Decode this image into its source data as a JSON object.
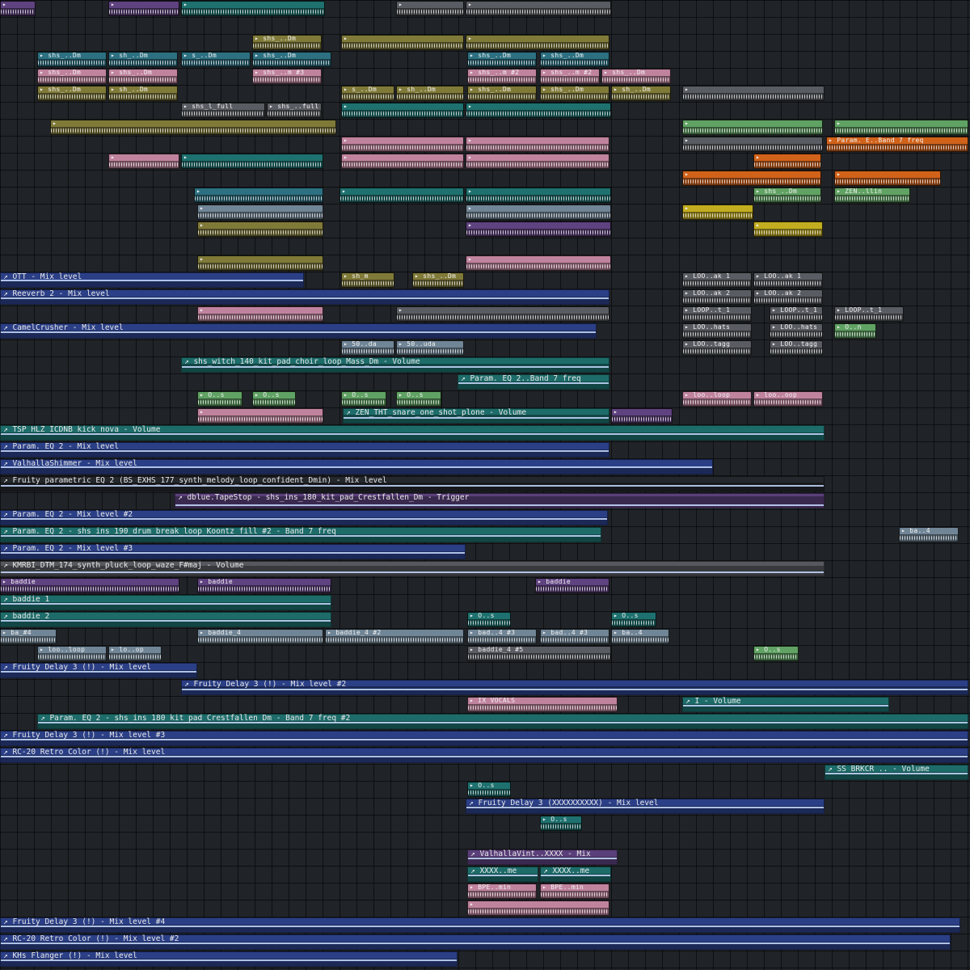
{
  "app": {
    "name": "FL Studio",
    "view": "Playlist"
  },
  "colors": {
    "blue": "#2b3f86",
    "teal": "#1d6c6a",
    "purple": "#5a3f7a",
    "pink": "#b77d96",
    "olive": "#7a7436",
    "cyan": "#2a6b7b",
    "gray": "#55585d",
    "orange": "#c75d19",
    "yellow": "#b9a51e",
    "green": "#5b9a5e",
    "steel": "#6b7f8f"
  },
  "automation": [
    {
      "label": "OTT - Mix level",
      "row": 16,
      "start": 0,
      "end": 376,
      "color": "blue",
      "level": 0.55
    },
    {
      "label": "Reeverb 2 - Mix level",
      "row": 17,
      "start": 0,
      "end": 754,
      "color": "blue",
      "level": 0.45
    },
    {
      "label": "CamelCrusher - Mix level",
      "row": 19,
      "start": 0,
      "end": 738,
      "color": "blue",
      "level": 0.5
    },
    {
      "label": "shs_witch_140_kit_pad_choir_loop_Mass_Dm - Volume",
      "row": 21,
      "start": 224,
      "end": 754,
      "color": "teal",
      "level": 0.4
    },
    {
      "label": "Param. EQ 2..Band 7 freq",
      "row": 22,
      "start": 566,
      "end": 754,
      "color": "teal",
      "level": 0.5
    },
    {
      "label": "ZEN_THT_snare_one_shot_plone - Volume",
      "row": 24,
      "start": 424,
      "end": 754,
      "color": "teal",
      "level": 0.4
    },
    {
      "label": "TSP_HLZ_ICDNB_kick_nova - Volume",
      "row": 25,
      "start": 0,
      "end": 1020,
      "color": "teal",
      "level": 0.45
    },
    {
      "label": "Param. EQ 2 - Mix level",
      "row": 26,
      "start": 0,
      "end": 754,
      "color": "blue",
      "level": 0.5
    },
    {
      "label": "ValhallaShimmer - Mix level",
      "row": 27,
      "start": 0,
      "end": 882,
      "color": "blue",
      "level": 0.55
    },
    {
      "label": "Fruity parametric EQ 2 (BS_EXHS_177_synth_melody_loop_confident_Dmin) - Mix level",
      "row": 28,
      "start": 0,
      "end": 1020,
      "color": "dark",
      "level": 0.4
    },
    {
      "label": "dblue.TapeStop - shs_ins_180_kit_pad_Crestfallen_Dm - Trigger",
      "row": 29,
      "start": 216,
      "end": 1020,
      "color": "purple",
      "level": 0.2
    },
    {
      "label": "Param. EQ 2 - Mix level #2",
      "row": 30,
      "start": 0,
      "end": 752,
      "color": "blue",
      "level": 0.5
    },
    {
      "label": "Param. EQ 2 - shs_ins_190_drum_break_loop_Koontz_fill #2 - Band 7 freq",
      "row": 31,
      "start": 0,
      "end": 744,
      "color": "teal",
      "level": 0.5
    },
    {
      "label": "Param. EQ 2 - Mix level #3",
      "row": 32,
      "start": 0,
      "end": 576,
      "color": "blue",
      "level": 0.5
    },
    {
      "label": "KMRBI_DTM_174_synth_pluck_loop_waze_F#maj - Volume",
      "row": 33,
      "start": 0,
      "end": 1020,
      "color": "gray",
      "level": 0.3
    },
    {
      "label": "baddie_1",
      "row": 35,
      "start": 0,
      "end": 410,
      "color": "teal",
      "level": 0.5
    },
    {
      "label": "baddie_2",
      "row": 36,
      "start": 0,
      "end": 410,
      "color": "teal",
      "level": 0.5
    },
    {
      "label": "Fruity Delay 3 (!) - Mix level",
      "row": 39,
      "start": 0,
      "end": 244,
      "color": "blue",
      "level": 0.5
    },
    {
      "label": "Fruity Delay 3 (!) - Mix level #2",
      "row": 40,
      "start": 224,
      "end": 1198,
      "color": "blue",
      "level": 0.4
    },
    {
      "label": "I - Volume",
      "row": 41,
      "start": 844,
      "end": 1100,
      "color": "teal",
      "level": 0.5
    },
    {
      "label": "Param. EQ 2 - shs_ins_180_kit_pad_Crestfallen_Dm - Band 7 freq #2",
      "row": 42,
      "start": 46,
      "end": 1198,
      "color": "teal",
      "level": 0.5
    },
    {
      "label": "Fruity Delay 3 (!) - Mix level #3",
      "row": 43,
      "start": 0,
      "end": 1198,
      "color": "blue",
      "level": 0.5
    },
    {
      "label": "RC-20 Retro Color (!) - Mix level",
      "row": 44,
      "start": 0,
      "end": 1198,
      "color": "blue",
      "level": 0.5
    },
    {
      "label": "SS_BRKCR_.. - Volume",
      "row": 45,
      "start": 1020,
      "end": 1198,
      "color": "teal",
      "level": 0.5
    },
    {
      "label": "Fruity Delay 3 (XXXXXXXXXX) - Mix level",
      "row": 47,
      "start": 576,
      "end": 1020,
      "color": "blue",
      "level": 0.5
    },
    {
      "label": "ValhallaVint..XXXX - Mix",
      "row": 50,
      "start": 578,
      "end": 764,
      "color": "purple",
      "level": 0.5
    },
    {
      "label": "XXXX..me",
      "row": 51,
      "start": 578,
      "end": 666,
      "color": "teal",
      "level": 0.5
    },
    {
      "label": "XXXX..me",
      "row": 51,
      "start": 668,
      "end": 756,
      "color": "teal",
      "level": 0.5
    },
    {
      "label": "Fruity Delay 3 (!) - Mix level #4",
      "row": 54,
      "start": 0,
      "end": 1188,
      "color": "blue",
      "level": 0.5
    },
    {
      "label": "RC-20 Retro Color (!) - Mix level #2",
      "row": 55,
      "start": 0,
      "end": 1176,
      "color": "blue",
      "level": 0.5
    },
    {
      "label": "KHs Flanger (!) - Mix level",
      "row": 56,
      "start": 0,
      "end": 566,
      "color": "blue",
      "level": 0.5
    }
  ],
  "clips": [
    {
      "label": "",
      "row": 0,
      "start": 0,
      "end": 44,
      "color": "purple"
    },
    {
      "label": "",
      "row": 0,
      "start": 134,
      "end": 222,
      "color": "purple"
    },
    {
      "label": "",
      "row": 0,
      "start": 224,
      "end": 402,
      "color": "teal"
    },
    {
      "label": "",
      "row": 0,
      "start": 490,
      "end": 574,
      "color": "gray"
    },
    {
      "label": "",
      "row": 0,
      "start": 576,
      "end": 756,
      "color": "gray"
    },
    {
      "label": "shs_..Dm",
      "row": 2,
      "start": 312,
      "end": 398,
      "color": "olive"
    },
    {
      "label": "",
      "row": 2,
      "start": 422,
      "end": 574,
      "color": "olive"
    },
    {
      "label": "",
      "row": 2,
      "start": 576,
      "end": 754,
      "color": "olive"
    },
    {
      "label": "shs_..Dm",
      "row": 3,
      "start": 46,
      "end": 132,
      "color": "cyan"
    },
    {
      "label": "sh_..Dm",
      "row": 3,
      "start": 134,
      "end": 220,
      "color": "cyan"
    },
    {
      "label": "s_..Dm",
      "row": 3,
      "start": 224,
      "end": 310,
      "color": "cyan"
    },
    {
      "label": "shs_..Dm",
      "row": 3,
      "start": 312,
      "end": 410,
      "color": "cyan"
    },
    {
      "label": "shs_..Dm",
      "row": 3,
      "start": 578,
      "end": 664,
      "color": "cyan"
    },
    {
      "label": "shs_..Dm",
      "row": 3,
      "start": 668,
      "end": 754,
      "color": "cyan"
    },
    {
      "label": "shs_..Dm",
      "row": 4,
      "start": 46,
      "end": 132,
      "color": "pink"
    },
    {
      "label": "shs_..Dm",
      "row": 4,
      "start": 134,
      "end": 220,
      "color": "pink"
    },
    {
      "label": "shs_..m #3",
      "row": 4,
      "start": 312,
      "end": 398,
      "color": "pink"
    },
    {
      "label": "shs_..m #2",
      "row": 4,
      "start": 578,
      "end": 664,
      "color": "pink"
    },
    {
      "label": "shs_..m #2",
      "row": 4,
      "start": 668,
      "end": 742,
      "color": "pink"
    },
    {
      "label": "shs_..Dm",
      "row": 4,
      "start": 744,
      "end": 830,
      "color": "pink"
    },
    {
      "label": "shs_..Dm",
      "row": 5,
      "start": 46,
      "end": 132,
      "color": "olive"
    },
    {
      "label": "sh_..Dm",
      "row": 5,
      "start": 134,
      "end": 220,
      "color": "olive"
    },
    {
      "label": "s_..Dm",
      "row": 5,
      "start": 422,
      "end": 488,
      "color": "olive"
    },
    {
      "label": "sh_..Dm",
      "row": 5,
      "start": 490,
      "end": 574,
      "color": "olive"
    },
    {
      "label": "shs_..Dm",
      "row": 5,
      "start": 578,
      "end": 664,
      "color": "olive"
    },
    {
      "label": "shs_..Dm",
      "row": 5,
      "start": 668,
      "end": 754,
      "color": "olive"
    },
    {
      "label": "sh_..Dm",
      "row": 5,
      "start": 756,
      "end": 830,
      "color": "olive"
    },
    {
      "label": "shs_l_full",
      "row": 6,
      "start": 224,
      "end": 328,
      "color": "gray"
    },
    {
      "label": "shs_..full",
      "row": 6,
      "start": 330,
      "end": 398,
      "color": "gray"
    },
    {
      "label": "",
      "row": 6,
      "start": 422,
      "end": 574,
      "color": "teal"
    },
    {
      "label": "",
      "row": 6,
      "start": 576,
      "end": 756,
      "color": "teal"
    },
    {
      "label": "",
      "row": 5,
      "start": 844,
      "end": 1020,
      "color": "gray"
    },
    {
      "label": "",
      "row": 7,
      "start": 62,
      "end": 416,
      "color": "olive"
    },
    {
      "label": "",
      "row": 7,
      "start": 844,
      "end": 1018,
      "color": "green"
    },
    {
      "label": "",
      "row": 7,
      "start": 1032,
      "end": 1198,
      "color": "green"
    },
    {
      "label": "",
      "row": 8,
      "start": 422,
      "end": 574,
      "color": "pink"
    },
    {
      "label": "",
      "row": 8,
      "start": 576,
      "end": 754,
      "color": "pink"
    },
    {
      "label": "",
      "row": 8,
      "start": 844,
      "end": 1018,
      "color": "gray"
    },
    {
      "label": "Param. E..Band 7 freq",
      "row": 8,
      "start": 1022,
      "end": 1198,
      "color": "orange"
    },
    {
      "label": "",
      "row": 9,
      "start": 134,
      "end": 222,
      "color": "pink"
    },
    {
      "label": "",
      "row": 9,
      "start": 224,
      "end": 400,
      "color": "teal"
    },
    {
      "label": "",
      "row": 9,
      "start": 422,
      "end": 574,
      "color": "pink"
    },
    {
      "label": "",
      "row": 9,
      "start": 576,
      "end": 754,
      "color": "pink"
    },
    {
      "label": "",
      "row": 9,
      "start": 932,
      "end": 1016,
      "color": "orange"
    },
    {
      "label": "",
      "row": 10,
      "start": 844,
      "end": 1016,
      "color": "orange"
    },
    {
      "label": "",
      "row": 10,
      "start": 1032,
      "end": 1164,
      "color": "orange"
    },
    {
      "label": "",
      "row": 11,
      "start": 240,
      "end": 400,
      "color": "cyan"
    },
    {
      "label": "",
      "row": 11,
      "start": 420,
      "end": 574,
      "color": "teal"
    },
    {
      "label": "",
      "row": 11,
      "start": 576,
      "end": 756,
      "color": "teal"
    },
    {
      "label": "shs_..Dm",
      "row": 11,
      "start": 932,
      "end": 1016,
      "color": "green"
    },
    {
      "label": "ZEN..llin",
      "row": 11,
      "start": 1032,
      "end": 1126,
      "color": "green"
    },
    {
      "label": "",
      "row": 12,
      "start": 244,
      "end": 400,
      "color": "steel"
    },
    {
      "label": "",
      "row": 12,
      "start": 576,
      "end": 756,
      "color": "steel"
    },
    {
      "label": "",
      "row": 12,
      "start": 844,
      "end": 932,
      "color": "yellow"
    },
    {
      "label": "",
      "row": 13,
      "start": 244,
      "end": 400,
      "color": "olive"
    },
    {
      "label": "",
      "row": 13,
      "start": 576,
      "end": 756,
      "color": "purple"
    },
    {
      "label": "",
      "row": 13,
      "start": 932,
      "end": 1018,
      "color": "yellow"
    },
    {
      "label": "",
      "row": 15,
      "start": 244,
      "end": 400,
      "color": "olive"
    },
    {
      "label": "",
      "row": 15,
      "start": 576,
      "end": 756,
      "color": "pink"
    },
    {
      "label": "sh_m",
      "row": 16,
      "start": 422,
      "end": 488,
      "color": "olive"
    },
    {
      "label": "shs_..Dm",
      "row": 16,
      "start": 510,
      "end": 574,
      "color": "olive"
    },
    {
      "label": "LOO..ak 1",
      "row": 16,
      "start": 844,
      "end": 930,
      "color": "gray"
    },
    {
      "label": "LOO..ak 1",
      "row": 16,
      "start": 932,
      "end": 1018,
      "color": "gray"
    },
    {
      "label": "LOO..ak 2",
      "row": 17,
      "start": 844,
      "end": 930,
      "color": "gray"
    },
    {
      "label": "LOO..ak 2",
      "row": 17,
      "start": 932,
      "end": 1018,
      "color": "gray"
    },
    {
      "label": "",
      "row": 18,
      "start": 244,
      "end": 400,
      "color": "pink"
    },
    {
      "label": "",
      "row": 18,
      "start": 490,
      "end": 754,
      "color": "gray"
    },
    {
      "label": "LOOP..t_1",
      "row": 18,
      "start": 844,
      "end": 930,
      "color": "gray"
    },
    {
      "label": "LOOP..t_1",
      "row": 18,
      "start": 952,
      "end": 1018,
      "color": "gray"
    },
    {
      "label": "LOOP..t_1",
      "row": 18,
      "start": 1032,
      "end": 1118,
      "color": "gray"
    },
    {
      "label": "LOO..hats",
      "row": 19,
      "start": 844,
      "end": 930,
      "color": "gray"
    },
    {
      "label": "LOO..hats",
      "row": 19,
      "start": 952,
      "end": 1018,
      "color": "gray"
    },
    {
      "label": "O..n",
      "row": 19,
      "start": 1032,
      "end": 1084,
      "color": "green"
    },
    {
      "label": "50..da",
      "row": 20,
      "start": 422,
      "end": 488,
      "color": "steel"
    },
    {
      "label": "50..uda",
      "row": 20,
      "start": 490,
      "end": 574,
      "color": "steel"
    },
    {
      "label": "LOO..tagg",
      "row": 20,
      "start": 844,
      "end": 930,
      "color": "gray"
    },
    {
      "label": "LOO..tagg",
      "row": 20,
      "start": 952,
      "end": 1018,
      "color": "gray"
    },
    {
      "label": "O..s",
      "row": 23,
      "start": 244,
      "end": 300,
      "color": "green"
    },
    {
      "label": "O..s",
      "row": 23,
      "start": 312,
      "end": 366,
      "color": "green"
    },
    {
      "label": "O..s",
      "row": 23,
      "start": 422,
      "end": 478,
      "color": "green"
    },
    {
      "label": "O..s",
      "row": 23,
      "start": 490,
      "end": 546,
      "color": "green"
    },
    {
      "label": "loo..loop",
      "row": 23,
      "start": 844,
      "end": 930,
      "color": "pink"
    },
    {
      "label": "loo..oop",
      "row": 23,
      "start": 932,
      "end": 1018,
      "color": "pink"
    },
    {
      "label": "",
      "row": 24,
      "start": 244,
      "end": 400,
      "color": "pink"
    },
    {
      "label": "",
      "row": 24,
      "start": 756,
      "end": 832,
      "color": "purple"
    },
    {
      "label": "baddie",
      "row": 34,
      "start": 0,
      "end": 222,
      "color": "purple"
    },
    {
      "label": "baddie",
      "row": 34,
      "start": 244,
      "end": 410,
      "color": "purple"
    },
    {
      "label": "baddie",
      "row": 34,
      "start": 662,
      "end": 754,
      "color": "purple"
    },
    {
      "label": "O..s",
      "row": 36,
      "start": 578,
      "end": 632,
      "color": "teal"
    },
    {
      "label": "O..s",
      "row": 36,
      "start": 756,
      "end": 812,
      "color": "teal"
    },
    {
      "label": "ba_#4",
      "row": 37,
      "start": 0,
      "end": 70,
      "color": "steel"
    },
    {
      "label": "baddie_4",
      "row": 37,
      "start": 244,
      "end": 400,
      "color": "steel"
    },
    {
      "label": "baddie_4 #2",
      "row": 37,
      "start": 402,
      "end": 574,
      "color": "steel"
    },
    {
      "label": "bad..4 #3",
      "row": 37,
      "start": 578,
      "end": 664,
      "color": "steel"
    },
    {
      "label": "bad..4 #3",
      "row": 37,
      "start": 668,
      "end": 754,
      "color": "steel"
    },
    {
      "label": "ba..4",
      "row": 37,
      "start": 756,
      "end": 828,
      "color": "steel"
    },
    {
      "label": "loo..loop",
      "row": 38,
      "start": 46,
      "end": 132,
      "color": "steel"
    },
    {
      "label": "lo..op",
      "row": 38,
      "start": 134,
      "end": 200,
      "color": "steel"
    },
    {
      "label": "baddie_4 #5",
      "row": 38,
      "start": 578,
      "end": 756,
      "color": "gray"
    },
    {
      "label": "O..s",
      "row": 38,
      "start": 932,
      "end": 988,
      "color": "green"
    },
    {
      "label": "IX VOCALS",
      "row": 41,
      "start": 578,
      "end": 764,
      "color": "pink"
    },
    {
      "label": "ba..4",
      "row": 31,
      "start": 1112,
      "end": 1186,
      "color": "steel"
    },
    {
      "label": "O..s",
      "row": 46,
      "start": 578,
      "end": 632,
      "color": "teal"
    },
    {
      "label": "O..s",
      "row": 48,
      "start": 668,
      "end": 720,
      "color": "teal"
    },
    {
      "label": "BPE..min",
      "row": 52,
      "start": 578,
      "end": 664,
      "color": "pink"
    },
    {
      "label": "BPE..min",
      "row": 52,
      "start": 668,
      "end": 754,
      "color": "pink"
    },
    {
      "label": "",
      "row": 53,
      "start": 578,
      "end": 754,
      "color": "pink"
    }
  ]
}
